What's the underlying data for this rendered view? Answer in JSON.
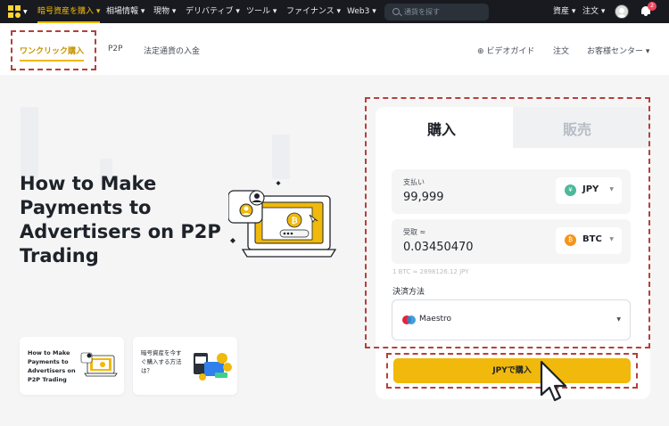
{
  "topnav": {
    "items": [
      {
        "label": "暗号資産を購入 ▾"
      },
      {
        "label": "相場情報 ▾"
      },
      {
        "label": "現物 ▾"
      },
      {
        "label": "デリバティブ ▾"
      },
      {
        "label": "ツール ▾"
      },
      {
        "label": "ファイナンス ▾"
      },
      {
        "label": "Web3 ▾"
      }
    ],
    "search_placeholder": "通貨を探す",
    "right_items": [
      {
        "label": "資産 ▾"
      },
      {
        "label": "注文 ▾"
      }
    ],
    "notification_count": "2"
  },
  "subnav": {
    "tabs": [
      {
        "label": "ワンクリック購入"
      },
      {
        "label": "P2P"
      },
      {
        "label": "法定通貨の入金"
      }
    ],
    "right_items": [
      {
        "label": "⊕ ビデオガイド"
      },
      {
        "label": "注文"
      },
      {
        "label": "お客様センター ▾"
      }
    ]
  },
  "hero": {
    "title": "How to Make Payments to Advertisers on P2P Trading"
  },
  "mini_cards": [
    {
      "text": "How to Make\nPayments to\nAdvertisers on\nP2P Trading"
    },
    {
      "text": "暗号資産を今す\nぐ購入する方法\nは？"
    }
  ],
  "trade": {
    "tab_buy": "購入",
    "tab_sell": "販売",
    "pay": {
      "label": "支払い",
      "value": "99,999",
      "currency": "JPY",
      "currency_symbol": "¥"
    },
    "receive": {
      "label": "受取 ≈",
      "value": "0.03450470",
      "currency": "BTC",
      "currency_symbol": "₿"
    },
    "rate": "1 BTC ≈ 2898126.12 JPY",
    "payment_method_label": "決済方法",
    "payment_method": "Maestro",
    "buy_button": "JPYで購入"
  },
  "colors": {
    "accent": "#F0B90B",
    "nav_bg": "#181A20",
    "annotation_red": "#B5403B"
  }
}
